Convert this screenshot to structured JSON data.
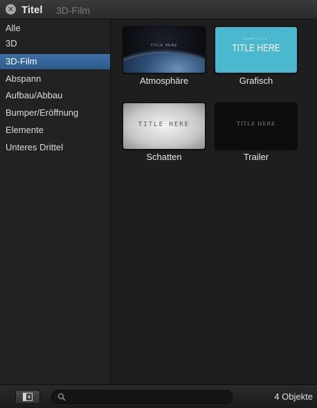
{
  "header": {
    "title": "Titel",
    "subtitle": "3D-Film"
  },
  "sidebar": {
    "items": [
      {
        "label": "Alle",
        "selected": false
      },
      {
        "label": "3D",
        "selected": false
      },
      {
        "label": "3D-Film",
        "selected": true
      },
      {
        "label": "Abspann",
        "selected": false
      },
      {
        "label": "Aufbau/Abbau",
        "selected": false
      },
      {
        "label": "Bumper/Eröffnung",
        "selected": false
      },
      {
        "label": "Elemente",
        "selected": false
      },
      {
        "label": "Unteres Drittel",
        "selected": false
      }
    ]
  },
  "content": {
    "tiles": [
      {
        "label": "Atmosphäre",
        "thumb_text": "TITLE HERE"
      },
      {
        "label": "Grafisch",
        "thumb_subtitle": "SUBTITLE",
        "thumb_text": "TITLE HERE"
      },
      {
        "label": "Schatten",
        "thumb_text": "TITLE HERE"
      },
      {
        "label": "Trailer",
        "thumb_text": "TITLE HERE"
      }
    ]
  },
  "footer": {
    "search_value": "",
    "count": "4 Objekte"
  },
  "colors": {
    "selection": "#2f5e90",
    "grafisch_bg": "#4bb8d0"
  }
}
